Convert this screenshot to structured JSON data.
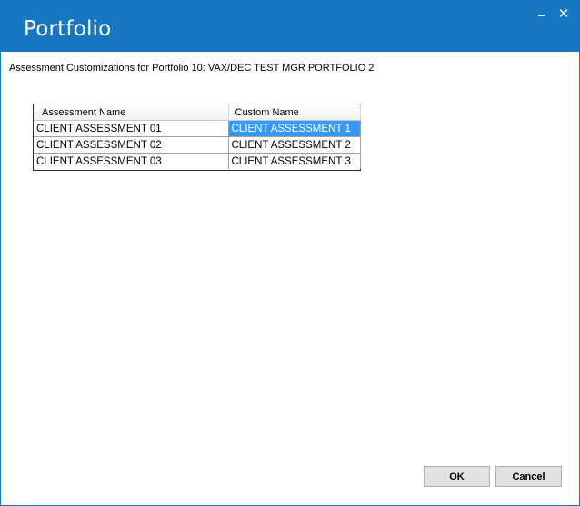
{
  "window": {
    "title": "Portfolio",
    "controls": {
      "minimize": "minimize",
      "close": "✕"
    },
    "accent_color": "#1777c4"
  },
  "subtitle": "Assessment Customizations for Portfolio 10: VAX/DEC TEST MGR PORTFOLIO 2",
  "grid": {
    "columns": [
      "Assessment Name",
      "Custom Name"
    ],
    "rows": [
      {
        "assessment_name": "CLIENT ASSESSMENT 01",
        "custom_name": "CLIENT ASSESSMENT 1",
        "selected": true
      },
      {
        "assessment_name": "CLIENT ASSESSMENT 02",
        "custom_name": "CLIENT ASSESSMENT 2",
        "selected": false
      },
      {
        "assessment_name": "CLIENT ASSESSMENT 03",
        "custom_name": "CLIENT ASSESSMENT 3",
        "selected": false
      }
    ],
    "selection_color": "#3399ff"
  },
  "buttons": {
    "ok_label": "OK",
    "cancel_label": "Cancel"
  }
}
